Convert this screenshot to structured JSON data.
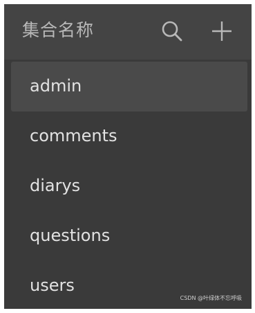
{
  "header": {
    "title": "集合名称",
    "search_icon": "search-icon",
    "add_icon": "plus-icon"
  },
  "collections": [
    {
      "label": "admin",
      "selected": true
    },
    {
      "label": "comments",
      "selected": false
    },
    {
      "label": "diarys",
      "selected": false
    },
    {
      "label": "questions",
      "selected": false
    },
    {
      "label": "users",
      "selected": false
    }
  ],
  "watermark": "CSDN @叶绿体不忘呼吸",
  "colors": {
    "panel_bg": "#3a3a3a",
    "header_bg": "#444444",
    "selected_bg": "#4a4a4a",
    "text": "#e2e2e2",
    "muted_text": "#b8b8b8"
  }
}
